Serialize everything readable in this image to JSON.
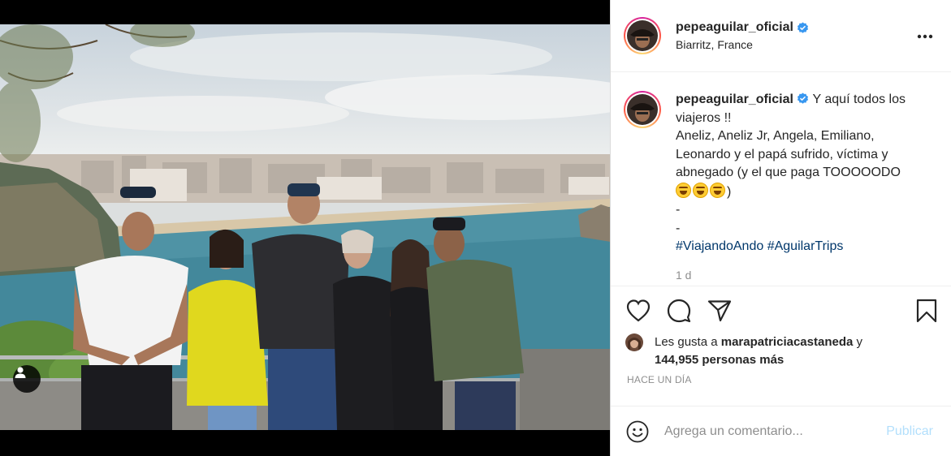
{
  "post": {
    "username": "pepeaguilar_oficial",
    "location": "Biarritz, France",
    "verified": true,
    "more_icon": "more-horizontal-icon",
    "caption_lines": [
      "Y aquí todos los",
      "viajeros !!",
      "Aneliz, Aneliz Jr, Angela, Emiliano,",
      "Leonardo y el papá sufrido, víctima y",
      "abnegado (y el que paga TOOOOODO",
      ")",
      "-",
      "-"
    ],
    "hashtags": [
      "#ViajandoAndo",
      "#AguilarTrips"
    ],
    "caption_time": "1 d",
    "likes": {
      "prefix": "Les gusta a",
      "liker": "marapatriciacastaneda",
      "joiner": "y",
      "count_text": "144,955 personas más"
    },
    "posted_ago": "HACE UN DÍA"
  },
  "actions": {
    "like_icon": "heart-icon",
    "comment_icon": "comment-icon",
    "share_icon": "paper-plane-icon",
    "save_icon": "bookmark-icon"
  },
  "comment_box": {
    "placeholder": "Agrega un comentario...",
    "publish_label": "Publicar",
    "emoji_icon": "smiley-icon"
  },
  "colors": {
    "accent_link": "#00376b",
    "verified_blue": "#3897f0",
    "publish_disabled": "#b2dffc",
    "muted": "#8e8e8e"
  }
}
